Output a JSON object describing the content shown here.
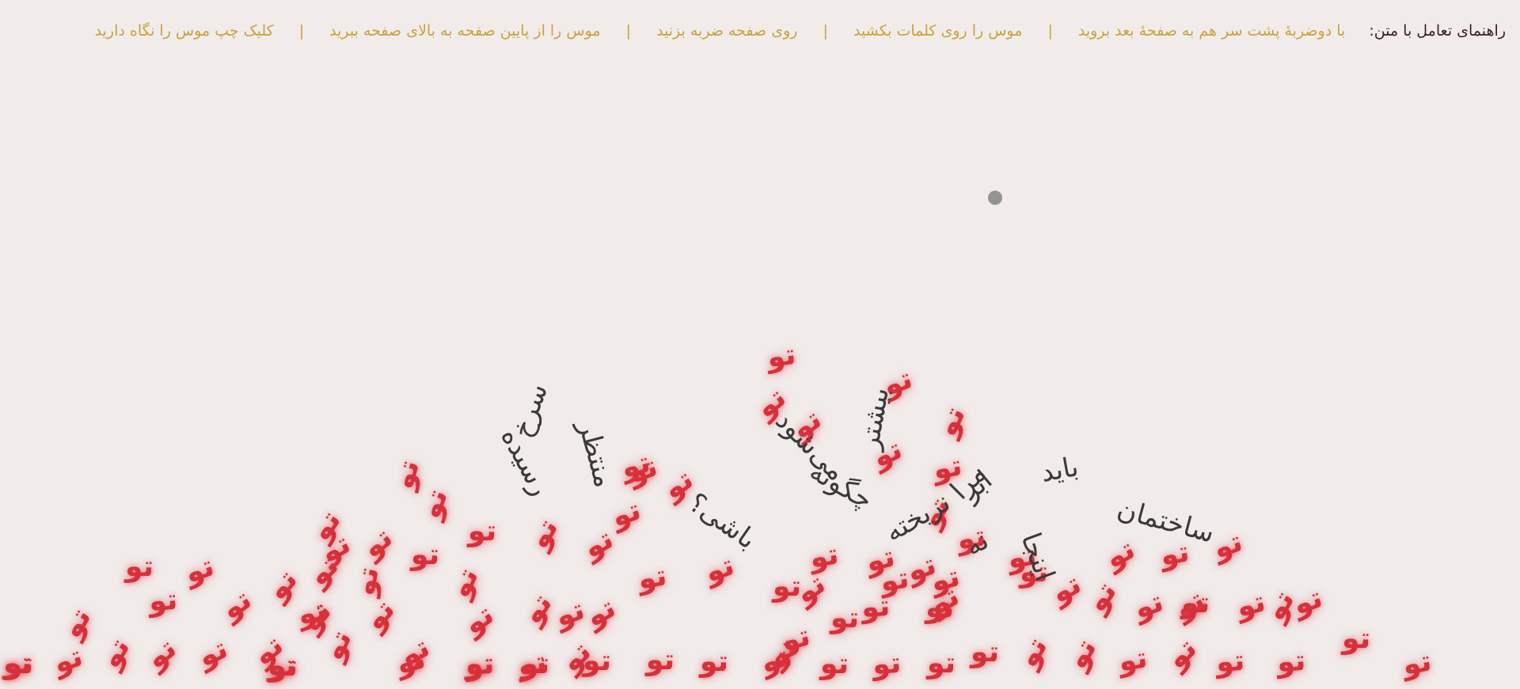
{
  "nav": {
    "title": "راهنمای تعامل با متن:",
    "items": [
      "با دوضربهٔ پشت سر هم به صفحهٔ بعد بروید",
      "موس را روی کلمات بکشید",
      "روی صفحه ضربه بزنید",
      "موس را از پایین صفحه به بالای صفحه ببرید",
      "کلیک چپ موس را نگاه دارید"
    ],
    "separator": "|"
  },
  "tile_text": "تو",
  "words": [
    "رسیده",
    "سرخ",
    "منتظر",
    "باشی؟",
    "چگونه",
    "می‌شود",
    "بیشتر",
    "نریخته",
    "ابر",
    "مرا",
    "نه",
    "باید",
    "اینجا",
    "ساختمان"
  ],
  "colors": {
    "tile": "#d7303a",
    "nav_link": "#c9a23c",
    "nav_title": "#3a1e2b",
    "background": "#f1ecea"
  }
}
